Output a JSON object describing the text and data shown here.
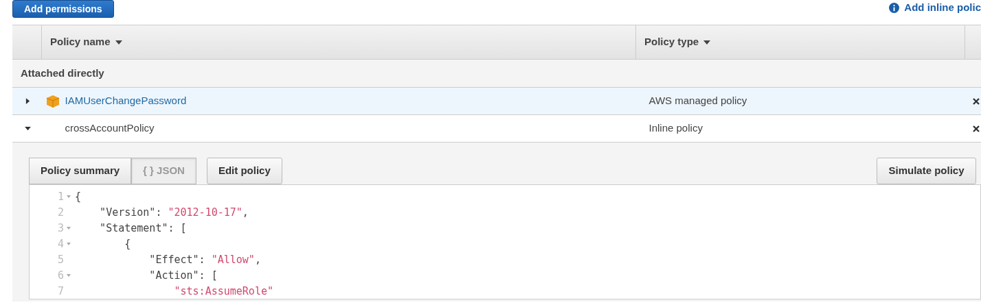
{
  "toolbar": {
    "add_button": "Add permissions",
    "inline_link": "Add inline polic"
  },
  "table": {
    "columns": [
      {
        "label": "Policy name"
      },
      {
        "label": "Policy type"
      }
    ],
    "group": "Attached directly",
    "rows": [
      {
        "name": "IAMUserChangePassword",
        "type": "AWS managed policy",
        "expanded": false,
        "kind": "managed",
        "selected": true
      },
      {
        "name": "crossAccountPolicy",
        "type": "Inline policy",
        "expanded": true,
        "kind": "inline",
        "selected": false
      }
    ]
  },
  "detail": {
    "tabs": [
      {
        "label": "Policy summary",
        "selected": false
      },
      {
        "label": "{ } JSON",
        "selected": true
      }
    ],
    "edit_button": "Edit policy",
    "simulate_button": "Simulate policy",
    "code": [
      {
        "number": "1",
        "fold": true,
        "tokens": [
          {
            "kind": "plain",
            "text": "{"
          }
        ]
      },
      {
        "number": "2",
        "fold": false,
        "tokens": [
          {
            "kind": "plain",
            "text": "    \"Version\": "
          },
          {
            "kind": "string",
            "text": "\"2012-10-17\""
          },
          {
            "kind": "plain",
            "text": ","
          }
        ]
      },
      {
        "number": "3",
        "fold": true,
        "tokens": [
          {
            "kind": "plain",
            "text": "    \"Statement\": ["
          }
        ]
      },
      {
        "number": "4",
        "fold": true,
        "tokens": [
          {
            "kind": "plain",
            "text": "        {"
          }
        ]
      },
      {
        "number": "5",
        "fold": false,
        "tokens": [
          {
            "kind": "plain",
            "text": "            \"Effect\": "
          },
          {
            "kind": "string",
            "text": "\"Allow\""
          },
          {
            "kind": "plain",
            "text": ","
          }
        ]
      },
      {
        "number": "6",
        "fold": true,
        "tokens": [
          {
            "kind": "plain",
            "text": "            \"Action\": ["
          }
        ]
      },
      {
        "number": "7",
        "fold": false,
        "tokens": [
          {
            "kind": "string",
            "text": "                \"sts:AssumeRole\""
          }
        ]
      }
    ]
  }
}
